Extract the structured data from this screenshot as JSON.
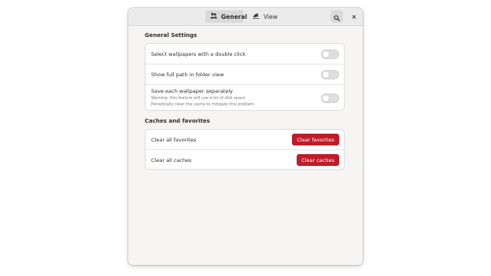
{
  "tabs": [
    {
      "label": "General",
      "icon": "people-icon",
      "active": true
    },
    {
      "label": "View",
      "icon": "view-icon",
      "active": false
    }
  ],
  "header": {
    "search_icon": "search-icon",
    "close_glyph": "×"
  },
  "general_settings": {
    "title": "General Settings",
    "rows": [
      {
        "label": "Select wallpapers with a double click",
        "enabled": false
      },
      {
        "label": "Show full path in folder view",
        "enabled": false
      },
      {
        "label": "Save each wallpaper separately",
        "sub1": "Warning: this feature will use a lot of disk space",
        "sub2": "Periodically clear the cache to mitigate this problem",
        "enabled": false
      }
    ]
  },
  "caches": {
    "title": "Caches and favorites",
    "rows": [
      {
        "label": "Clear all favorites",
        "button": "Clear favorites"
      },
      {
        "label": "Clear all caches",
        "button": "Clear caches"
      }
    ]
  },
  "colors": {
    "accent_destructive": "#c01c28",
    "window_bg": "#f6f5f4",
    "headerbar_bg": "#ebebeb"
  }
}
